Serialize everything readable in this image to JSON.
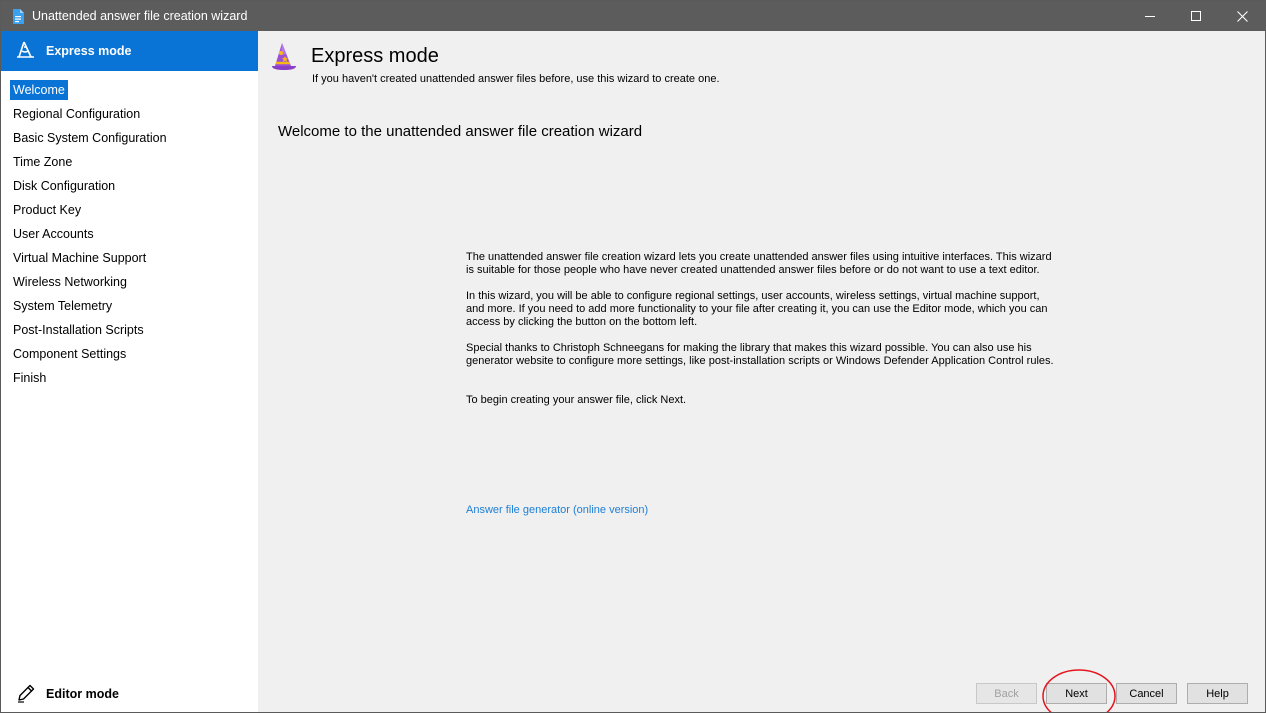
{
  "window": {
    "title": "Unattended answer file creation wizard"
  },
  "sidebar": {
    "header_label": "Express mode",
    "items": [
      {
        "label": "Welcome",
        "selected": true
      },
      {
        "label": "Regional Configuration",
        "selected": false
      },
      {
        "label": "Basic System Configuration",
        "selected": false
      },
      {
        "label": "Time Zone",
        "selected": false
      },
      {
        "label": "Disk Configuration",
        "selected": false
      },
      {
        "label": "Product Key",
        "selected": false
      },
      {
        "label": "User Accounts",
        "selected": false
      },
      {
        "label": "Virtual Machine Support",
        "selected": false
      },
      {
        "label": "Wireless Networking",
        "selected": false
      },
      {
        "label": "System Telemetry",
        "selected": false
      },
      {
        "label": "Post-Installation Scripts",
        "selected": false
      },
      {
        "label": "Component Settings",
        "selected": false
      },
      {
        "label": "Finish",
        "selected": false
      }
    ],
    "editor_mode_label": "Editor mode"
  },
  "main": {
    "title": "Express mode",
    "subtitle": "If you haven't created unattended answer files before, use this wizard to create one.",
    "heading": "Welcome to the unattended answer file creation wizard",
    "paragraphs": [
      "The unattended answer file creation wizard lets you create unattended answer files using intuitive interfaces. This wizard is suitable for those people who have never created unattended answer files before or do not want to use a text editor.",
      "In this wizard, you will be able to configure regional settings, user accounts, wireless settings, virtual machine support, and more. If you need to add more functionality to your file after creating it, you can use the Editor mode, which you can access by clicking the button on the bottom left.",
      "Special thanks to Christoph Schneegans for making the library that makes this wizard possible. You can also use his generator website to configure more settings, like post-installation scripts or Windows Defender Application Control rules.",
      "To begin creating your answer file, click Next."
    ],
    "link_label": "Answer file generator (online version)"
  },
  "footer": {
    "back_label": "Back",
    "back_enabled": false,
    "next_label": "Next",
    "cancel_label": "Cancel",
    "help_label": "Help"
  },
  "icons": {
    "app": "answer-file-icon",
    "sidebar_header": "wizard-hat-outline-icon",
    "page": "wizard-hat-icon",
    "editor": "pencil-icon"
  },
  "colors": {
    "accent": "#0a74d6",
    "titlebar": "#5c5c5c",
    "link": "#1e7fd6",
    "highlight_circle": "#e3141c"
  }
}
